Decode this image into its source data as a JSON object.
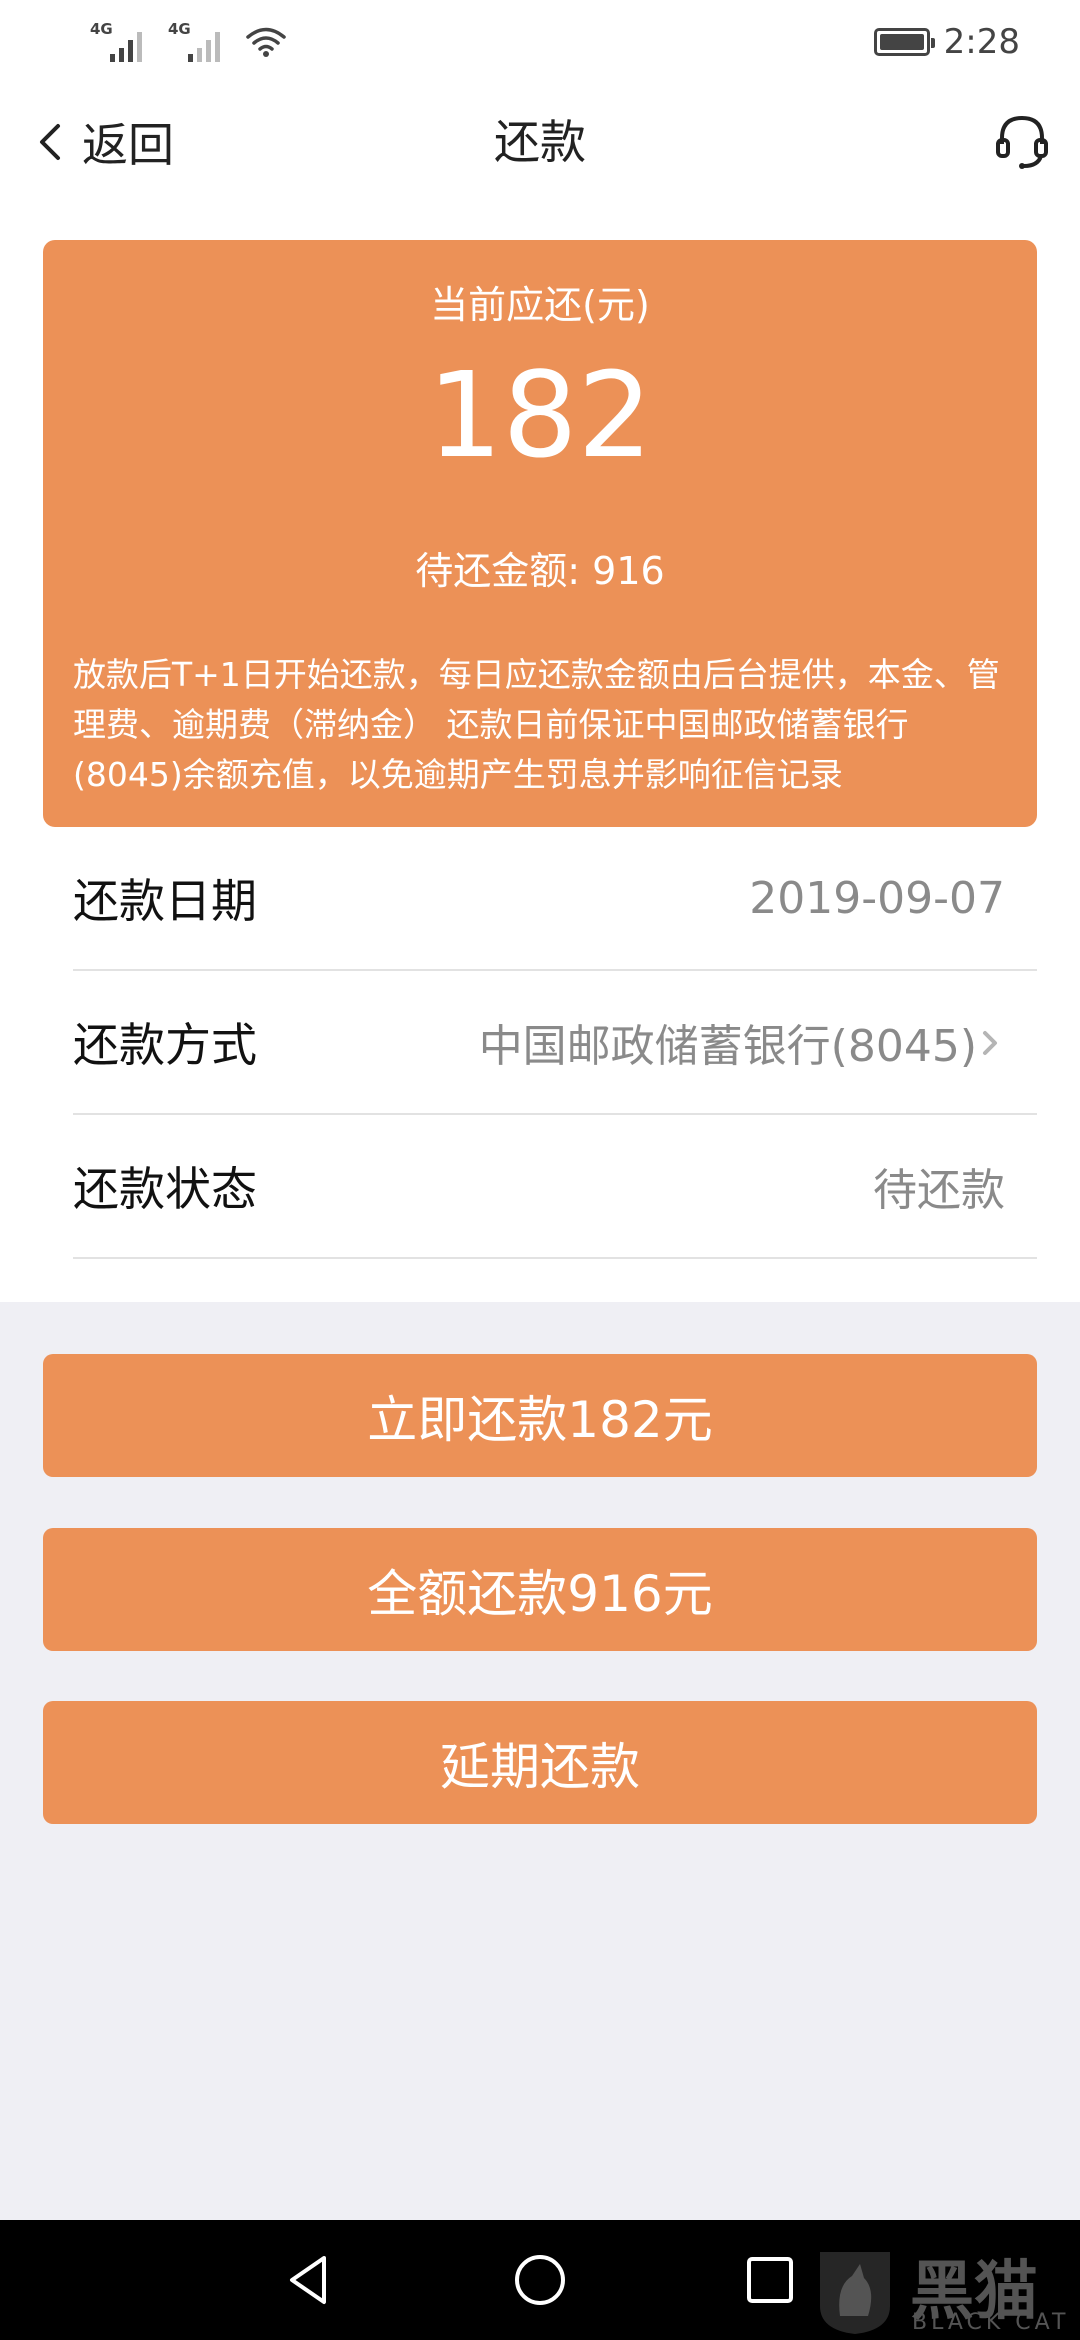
{
  "status_bar": {
    "signal1_label": "4G",
    "signal2_label": "4G",
    "time": "2:28"
  },
  "nav": {
    "back_label": "返回",
    "title": "还款"
  },
  "summary": {
    "current_due_label": "当前应还(元)",
    "current_due_amount": "182",
    "pending_label": "待还金额: ",
    "pending_amount": "916",
    "notice": "放款后T+1日开始还款，每日应还款金额由后台提供，本金、管理费、逾期费（滞纳金） 还款日前保证中国邮政储蓄银行(8045)余额充值，以免逾期产生罚息并影响征信记录"
  },
  "details": [
    {
      "label": "还款日期",
      "value": "2019-09-07"
    },
    {
      "label": "还款方式",
      "value": "中国邮政储蓄银行(8045)"
    },
    {
      "label": "还款状态",
      "value": "待还款"
    }
  ],
  "actions": {
    "pay_now": "立即还款182元",
    "pay_full": "全额还款916元",
    "extend": "延期还款"
  },
  "watermark": {
    "brand": "黑猫",
    "brand_en": "BLACK CAT"
  },
  "colors": {
    "accent": "#ec9157",
    "page_bg": "#efeff4"
  },
  "icons": {
    "back": "chevron-left-icon",
    "customer_service": "headset-icon",
    "detail_arrow": "chevron-right-icon",
    "sys_back": "triangle-back-icon",
    "sys_home": "circle-home-icon",
    "sys_recent": "square-recent-icon"
  }
}
